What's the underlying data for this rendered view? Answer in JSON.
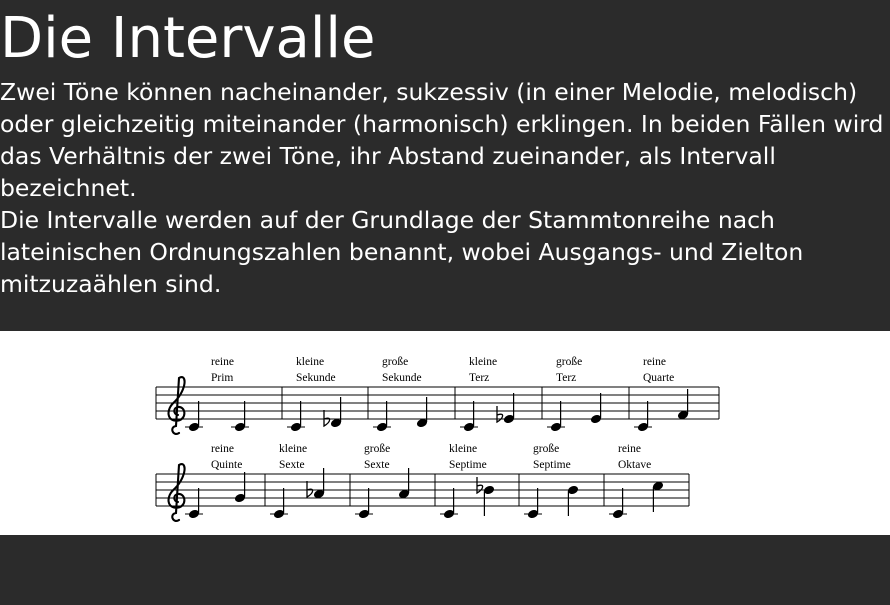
{
  "title": "Die Intervalle",
  "paragraphs": [
    "Zwei Töne können nacheinander, sukzessiv (in einer Melodie, melodisch) oder gleichzeitig miteinander (harmonisch) erklingen. In beiden Fällen wird das Verhältnis der zwei Töne, ihr Abstand zueinander, als Intervall bezeichnet.",
    "Die Intervalle werden auf der Grundlage der Stammtonreihe nach lateinischen Ordnungszahlen benannt, wobei Ausgangs- und Zielton mitzuzaählen sind."
  ],
  "intervals": [
    {
      "line1": "reine",
      "line2": "Prim",
      "step": 0,
      "accidental": ""
    },
    {
      "line1": "kleine",
      "line2": "Sekunde",
      "step": 1,
      "accidental": "flat"
    },
    {
      "line1": "große",
      "line2": "Sekunde",
      "step": 1,
      "accidental": ""
    },
    {
      "line1": "kleine",
      "line2": "Terz",
      "step": 2,
      "accidental": "flat"
    },
    {
      "line1": "große",
      "line2": "Terz",
      "step": 2,
      "accidental": ""
    },
    {
      "line1": "reine",
      "line2": "Quarte",
      "step": 3,
      "accidental": ""
    },
    {
      "line1": "reine",
      "line2": "Quinte",
      "step": 4,
      "accidental": ""
    },
    {
      "line1": "kleine",
      "line2": "Sexte",
      "step": 5,
      "accidental": "flat"
    },
    {
      "line1": "große",
      "line2": "Sexte",
      "step": 5,
      "accidental": ""
    },
    {
      "line1": "kleine",
      "line2": "Septime",
      "step": 6,
      "accidental": "flat"
    },
    {
      "line1": "große",
      "line2": "Septime",
      "step": 6,
      "accidental": ""
    },
    {
      "line1": "reine",
      "line2": "Oktave",
      "step": 7,
      "accidental": ""
    }
  ],
  "clef_icon": "treble-clef-icon"
}
